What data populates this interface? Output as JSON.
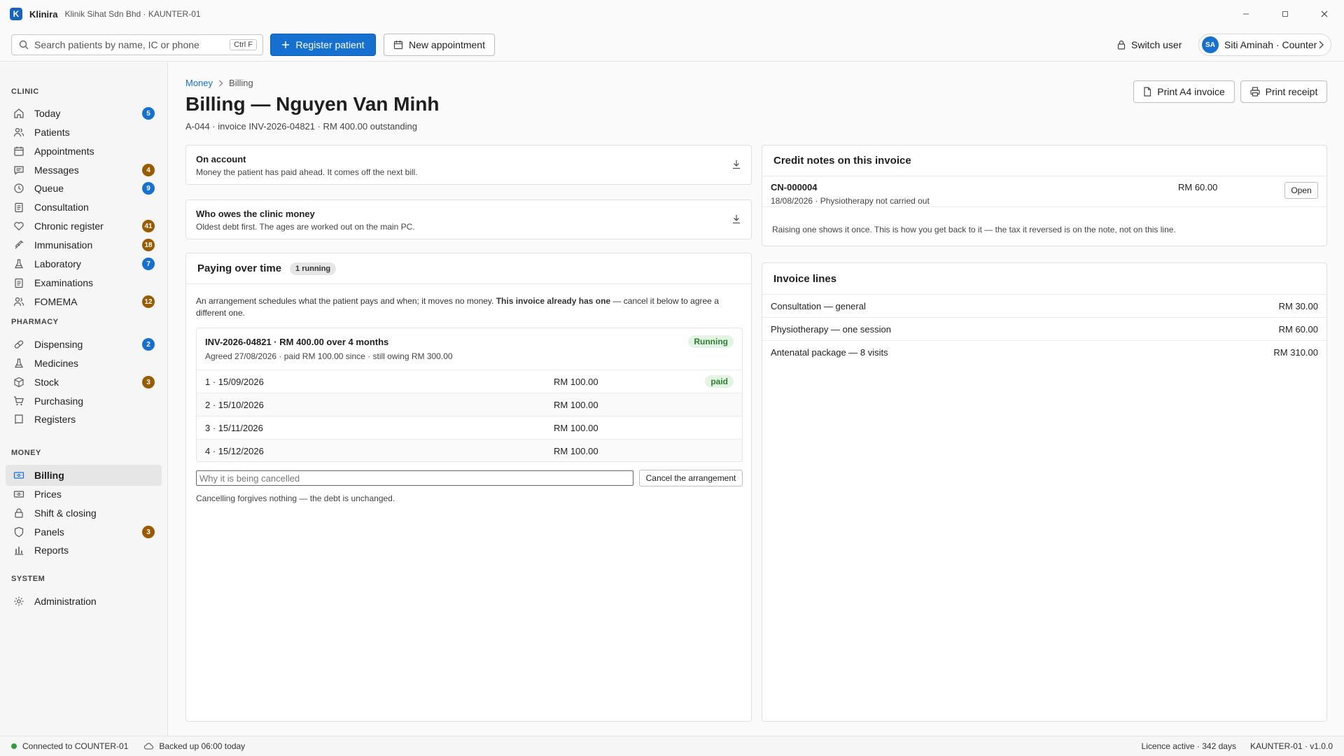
{
  "window": {
    "app_name": "Klinira",
    "app_logo_letter": "K",
    "subtitle": "Klinik Sihat Sdn Bhd · KAUNTER-01"
  },
  "toolbar": {
    "search_placeholder": "Search patients by name, IC or phone",
    "search_shortcut": "Ctrl F",
    "register_label": "Register patient",
    "new_appt_label": "New appointment",
    "switch_user_label": "Switch user",
    "user_initials": "SA",
    "user_label": "Siti Aminah · Counter"
  },
  "sidebar": {
    "sections": [
      {
        "title": "CLINIC",
        "items": [
          {
            "label": "Today",
            "icon": "home-icon",
            "badge": "5",
            "badge_color": "blue"
          },
          {
            "label": "Patients",
            "icon": "users-icon",
            "badge": null
          },
          {
            "label": "Appointments",
            "icon": "calendar-icon",
            "badge": null
          },
          {
            "label": "Messages",
            "icon": "message-icon",
            "badge": "4",
            "badge_color": "brown"
          },
          {
            "label": "Queue",
            "icon": "clock-icon",
            "badge": "9",
            "badge_color": "blue"
          },
          {
            "label": "Consultation",
            "icon": "clipboard-icon",
            "badge": null
          },
          {
            "label": "Chronic register",
            "icon": "heart-icon",
            "badge": "41",
            "badge_color": "brown"
          },
          {
            "label": "Immunisation",
            "icon": "syringe-icon",
            "badge": "18",
            "badge_color": "brown"
          },
          {
            "label": "Laboratory",
            "icon": "flask-icon",
            "badge": "7",
            "badge_color": "blue"
          },
          {
            "label": "Examinations",
            "icon": "clipboard-icon",
            "badge": null
          },
          {
            "label": "FOMEMA",
            "icon": "users-icon",
            "badge": "12",
            "badge_color": "brown"
          }
        ]
      },
      {
        "title": "PHARMACY",
        "items": [
          {
            "label": "Dispensing",
            "icon": "pill-icon",
            "badge": "2",
            "badge_color": "blue"
          },
          {
            "label": "Medicines",
            "icon": "flask-icon",
            "badge": null
          },
          {
            "label": "Stock",
            "icon": "box-icon",
            "badge": "3",
            "badge_color": "brown"
          },
          {
            "label": "Purchasing",
            "icon": "cart-icon",
            "badge": null
          },
          {
            "label": "Registers",
            "icon": "book-icon",
            "badge": null
          }
        ]
      },
      {
        "title": "MONEY",
        "items": [
          {
            "label": "Billing",
            "icon": "card-icon",
            "badge": null,
            "active": true
          },
          {
            "label": "Prices",
            "icon": "card-icon",
            "badge": null
          },
          {
            "label": "Shift & closing",
            "icon": "lock-icon",
            "badge": null
          },
          {
            "label": "Panels",
            "icon": "shield-icon",
            "badge": "3",
            "badge_color": "brown"
          },
          {
            "label": "Reports",
            "icon": "bar-chart-icon",
            "badge": null
          }
        ]
      },
      {
        "title": "SYSTEM",
        "items": [
          {
            "label": "Administration",
            "icon": "gear-icon",
            "badge": null
          }
        ]
      }
    ]
  },
  "page": {
    "breadcrumb": [
      "Money",
      "Billing"
    ],
    "title": "Billing — Nguyen Van Minh",
    "subtitle": "A-044 · invoice INV-2026-04821 · RM 400.00 outstanding",
    "print_a4_label": "Print A4 invoice",
    "print_receipt_label": "Print receipt"
  },
  "on_account": {
    "title": "On account",
    "desc": "Money the patient has paid ahead. It comes off the next bill."
  },
  "who_owes": {
    "title": "Who owes the clinic money",
    "desc": "Oldest debt first. The ages are worked out on the main PC."
  },
  "paying_over_time": {
    "title": "Paying over time",
    "chip": "1 running",
    "intro_a": "An arrangement schedules what the patient pays and when; it moves no money. ",
    "intro_bold": "This invoice already has one",
    "intro_b": " — cancel it below to agree a different one.",
    "plan_title": "INV-2026-04821 · RM 400.00 over 4 months",
    "plan_status": "Running",
    "plan_sub": "Agreed 27/08/2026 · paid RM 100.00 since · still owing RM 300.00",
    "installments": [
      {
        "label": "1 · 15/09/2026",
        "amount": "RM 100.00",
        "status": "paid"
      },
      {
        "label": "2 · 15/10/2026",
        "amount": "RM 100.00",
        "status": ""
      },
      {
        "label": "3 · 15/11/2026",
        "amount": "RM 100.00",
        "status": ""
      },
      {
        "label": "4 · 15/12/2026",
        "amount": "RM 100.00",
        "status": ""
      }
    ],
    "cancel_placeholder": "Why it is being cancelled",
    "cancel_button": "Cancel the arrangement",
    "cancel_note": "Cancelling forgives nothing — the debt is unchanged."
  },
  "credit_notes": {
    "title": "Credit notes on this invoice",
    "items": [
      {
        "number": "CN-000004",
        "amount": "RM 60.00",
        "detail": "18/08/2026 · Physiotherapy not carried out",
        "button": "Open"
      }
    ],
    "note": "Raising one shows it once. This is how you get back to it — the tax it reversed is on the note, not on this line."
  },
  "invoice_lines": {
    "title": "Invoice lines",
    "items": [
      {
        "desc": "Consultation — general",
        "amount": "RM 30.00"
      },
      {
        "desc": "Physiotherapy — one session",
        "amount": "RM 60.00"
      },
      {
        "desc": "Antenatal package — 8 visits",
        "amount": "RM 310.00"
      }
    ]
  },
  "status": {
    "connected": "Connected to COUNTER-01",
    "backup": "Backed up 06:00 today",
    "licence": "Licence active · 342 days",
    "version": "KAUNTER-01 · v1.0.0"
  },
  "colors": {
    "accent": "#1570cf",
    "badge_brown": "#9a5a00",
    "success_bg": "#e3f4e4",
    "success_fg": "#2e7d32"
  }
}
